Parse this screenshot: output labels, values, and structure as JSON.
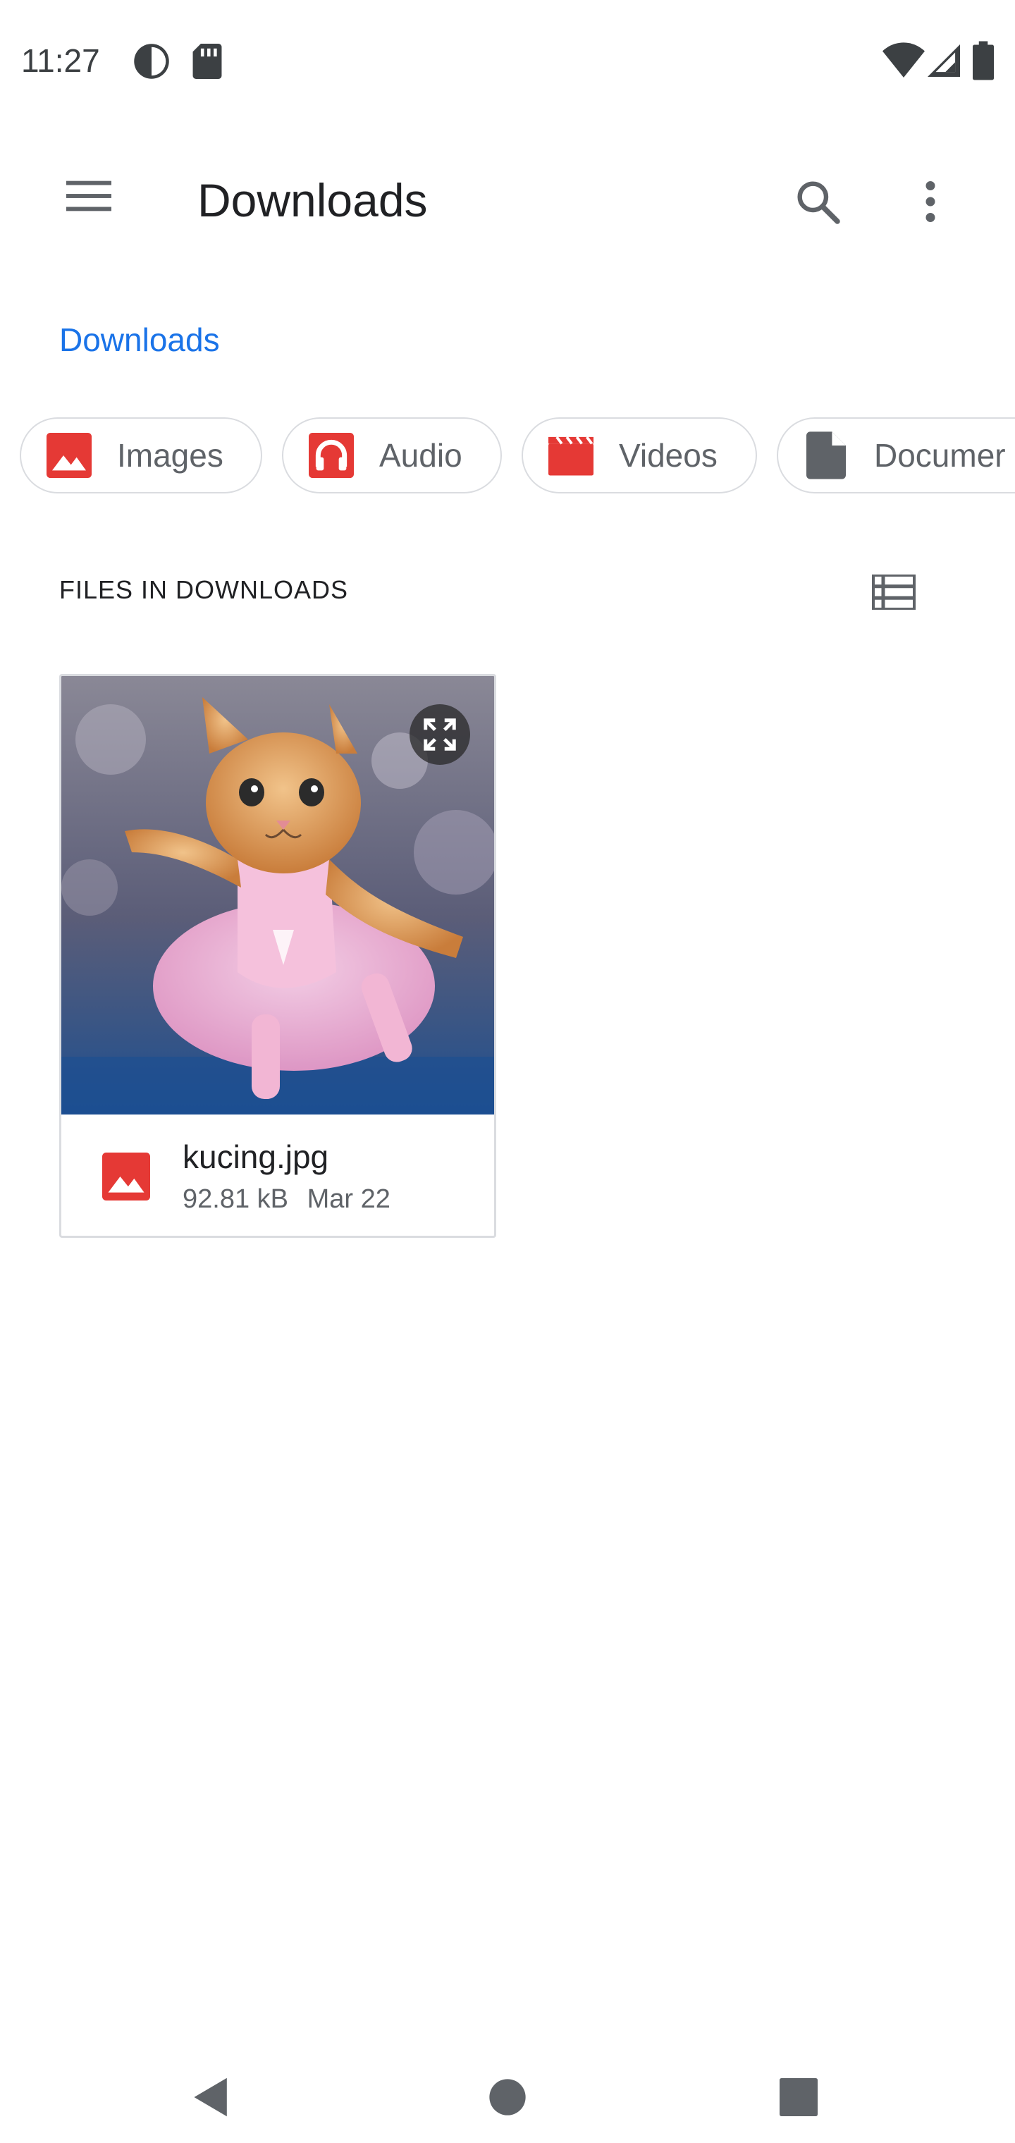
{
  "status_bar": {
    "time": "11:27",
    "icons": [
      "data-saver-icon",
      "sd-card-icon",
      "wifi-icon",
      "cellular-signal-icon",
      "battery-icon"
    ]
  },
  "toolbar": {
    "title": "Downloads",
    "menu_icon": "hamburger-menu-icon",
    "search_icon": "search-icon",
    "more_icon": "more-vert-icon"
  },
  "breadcrumb": {
    "label": "Downloads"
  },
  "chips": [
    {
      "label": "Images",
      "icon": "image-icon",
      "color": "#e53935"
    },
    {
      "label": "Audio",
      "icon": "headphones-icon",
      "color": "#e53935"
    },
    {
      "label": "Videos",
      "icon": "movie-icon",
      "color": "#e53935"
    },
    {
      "label": "Documer",
      "icon": "document-icon",
      "color": "#5f6368"
    }
  ],
  "section": {
    "title": "FILES IN DOWNLOADS",
    "view_toggle_icon": "list-view-icon"
  },
  "files": [
    {
      "name": "kucing.jpg",
      "size": "92.81 kB",
      "date": "Mar 22",
      "type_icon": "image-icon",
      "thumbnail": "kitten-in-pink-tutu-photo"
    }
  ],
  "nav_bar": {
    "back_icon": "back-icon",
    "home_icon": "home-icon",
    "recents_icon": "recents-icon"
  },
  "colors": {
    "accent": "#1a73e8",
    "file_type_red": "#e53935",
    "chip_border": "#dadce0",
    "secondary_text": "#5f6368"
  }
}
